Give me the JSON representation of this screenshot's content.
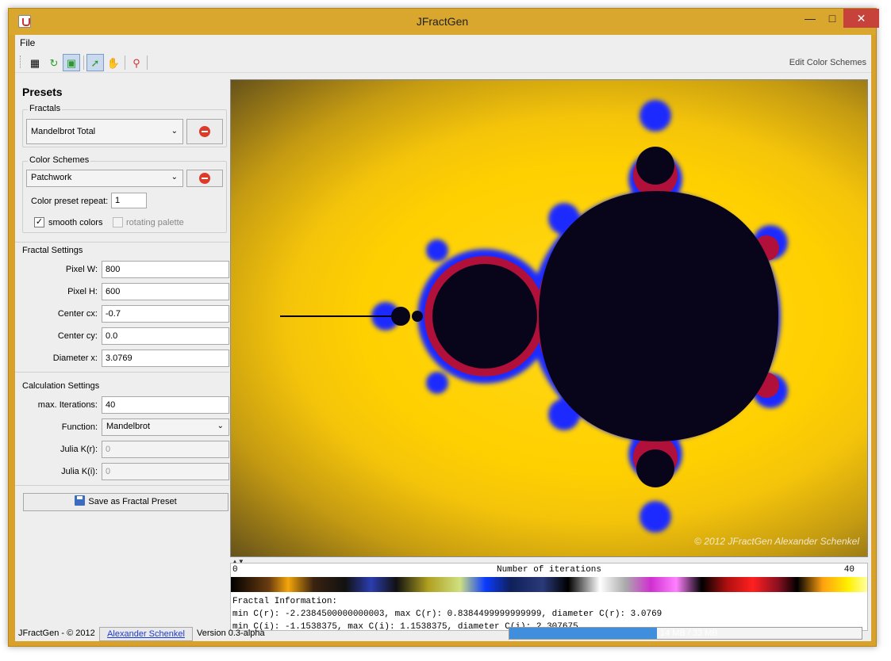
{
  "window": {
    "title": "JFractGen"
  },
  "menu": {
    "file": "File"
  },
  "toolbar": {
    "edit_color_schemes": "Edit Color Schemes"
  },
  "left": {
    "presets_title": "Presets",
    "fractals_group": "Fractals",
    "fractal_preset": "Mandelbrot Total",
    "color_schemes_group": "Color Schemes",
    "color_scheme": "Patchwork",
    "color_preset_repeat_label": "Color preset repeat:",
    "color_preset_repeat": "1",
    "smooth_colors": "smooth colors",
    "rotating_palette": "rotating palette",
    "fractal_settings": "Fractal Settings",
    "pixel_w_label": "Pixel W:",
    "pixel_w": "800",
    "pixel_h_label": "Pixel H:",
    "pixel_h": "600",
    "center_cx_label": "Center cx:",
    "center_cx": "-0.7",
    "center_cy_label": "Center cy:",
    "center_cy": "0.0",
    "diameter_label": "Diameter x:",
    "diameter": "3.0769",
    "calc_settings": "Calculation Settings",
    "max_iter_label": "max. Iterations:",
    "max_iter": "40",
    "function_label": "Function:",
    "function": "Mandelbrot",
    "julia_kr_label": "Julia K(r):",
    "julia_kr": "0",
    "julia_ki_label": "Julia K(i):",
    "julia_ki": "0",
    "save_button": "Save as Fractal Preset"
  },
  "canvas": {
    "copyright": "© 2012 JFractGen Alexander Schenkel"
  },
  "palette": {
    "min": "0",
    "title": "Number of iterations",
    "max": "40"
  },
  "info": {
    "heading": "Fractal Information:",
    "line1": "min C(r): -2.2384500000000003, max C(r): 0.8384499999999999, diameter C(r): 3.0769",
    "line2": "min C(i): -1.1538375, max C(i): 1.1538375, diameter C(i): 2.307675"
  },
  "status": {
    "left": "JFractGen - © 2012",
    "author": "Alexander Schenkel",
    "version": "Version 0.3-alpha",
    "memory": "14 MB / 33 MB",
    "memory_fraction": 0.42
  }
}
